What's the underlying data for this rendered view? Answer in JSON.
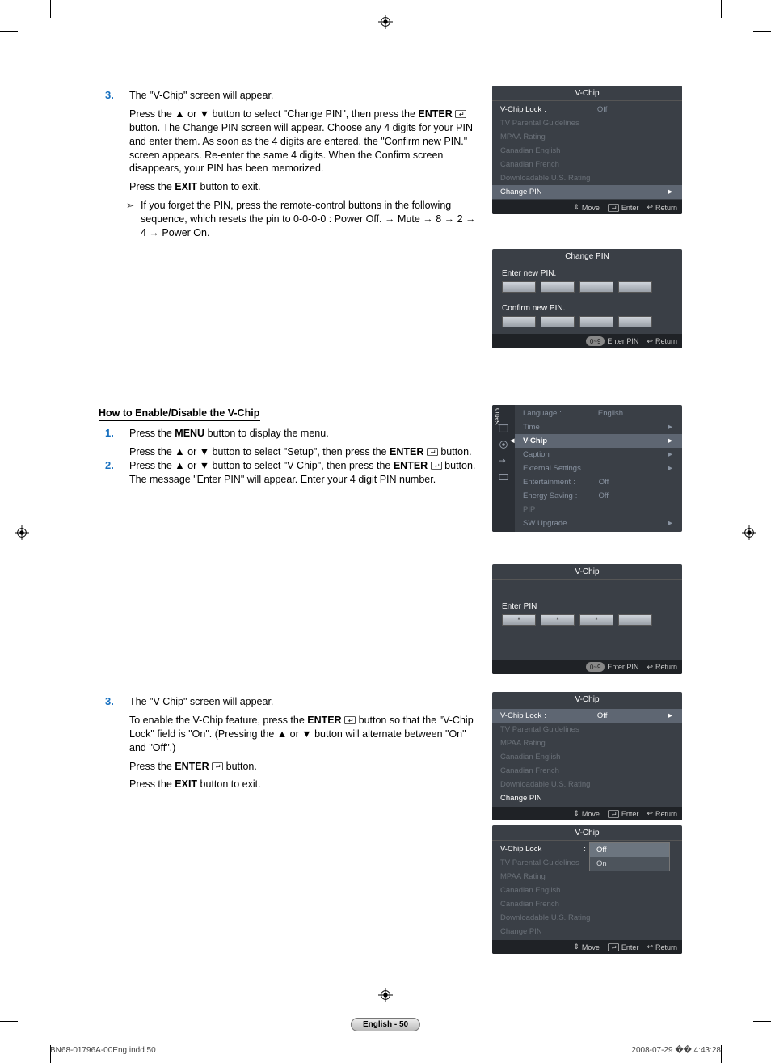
{
  "section1": {
    "step3_num": "3.",
    "step3a": "The \"V-Chip\" screen will appear.",
    "step3b_pre": "Press the ▲ or ▼ button to select \"Change PIN\", then press the ",
    "step3b_enter": "ENTER",
    "step3b_post": " button. The Change PIN screen will appear. Choose any 4 digits for your PIN and enter them. As soon as the 4 digits are entered, the \"Confirm new PIN.\" screen appears. Re-enter the same 4 digits. When the Confirm screen disappears, your PIN has been memorized.",
    "step3c_pre": "Press the ",
    "step3c_exit": "EXIT",
    "step3c_post": " button to exit.",
    "note": "If you forget the PIN, press the remote-control buttons in the following sequence, which resets the pin to 0-0-0-0 : Power Off. → Mute → 8 → 2 → 4 → Power On."
  },
  "section2": {
    "heading": "How to Enable/Disable the V-Chip",
    "step1_num": "1.",
    "step1a_pre": "Press the ",
    "step1a_menu": "MENU",
    "step1a_post": " button to display the menu.",
    "step1b_pre": "Press the ▲ or ▼ button to select \"Setup\", then press the ",
    "step1b_enter": "ENTER",
    "step1b_post": " button.",
    "step2_num": "2.",
    "step2a_pre": "Press the ▲ or ▼ button to select \"V-Chip\", then press the ",
    "step2a_enter": "ENTER",
    "step2a_post": " button. The message \"Enter PIN\" will appear. Enter your 4 digit PIN number."
  },
  "section3": {
    "step3_num": "3.",
    "step3a": "The \"V-Chip\" screen will appear.",
    "step3b_pre": "To enable the V-Chip feature, press the ",
    "step3b_enter": "ENTER",
    "step3b_post": " button so that the \"V-Chip Lock\" field is \"On\". (Pressing the ▲ or ▼ button will alternate between \"On\" and \"Off\".)",
    "step3c_pre": "Press the ",
    "step3c_enter": "ENTER",
    "step3c_post": " button.",
    "step3d_pre": "Press the ",
    "step3d_exit": "EXIT",
    "step3d_post": " button to exit."
  },
  "panel_vchip_top": {
    "title": "V-Chip",
    "rows": [
      {
        "label": "V-Chip Lock",
        "value": "Off",
        "style": "highlight"
      },
      {
        "label": "TV Parental Guidelines",
        "style": "disabled"
      },
      {
        "label": "MPAA Rating",
        "style": "disabled"
      },
      {
        "label": "Canadian English",
        "style": "disabled"
      },
      {
        "label": "Canadian French",
        "style": "disabled"
      },
      {
        "label": "Downloadable U.S. Rating",
        "style": "disabled"
      },
      {
        "label": "Change PIN",
        "style": "sel",
        "chev": "►"
      }
    ],
    "footer": {
      "move": "Move",
      "enter": "Enter",
      "return": "Return"
    }
  },
  "panel_change_pin": {
    "title": "Change PIN",
    "enter_label": "Enter new PIN.",
    "confirm_label": "Confirm new PIN.",
    "footer": {
      "badge": "0~9",
      "enter_pin": "Enter PIN",
      "return": "Return"
    }
  },
  "panel_setup": {
    "side_label": "Setup",
    "rows": [
      {
        "label": "Language",
        "value": "English"
      },
      {
        "label": "Time",
        "chev": "►"
      },
      {
        "label": "V-Chip",
        "style": "sel",
        "chev": "►"
      },
      {
        "label": "Caption",
        "chev": "►"
      },
      {
        "label": "External Settings",
        "chev": "►"
      },
      {
        "label": "Entertainment",
        "value": "Off"
      },
      {
        "label": "Energy Saving",
        "value": "Off"
      },
      {
        "label": "PIP",
        "style": "disabled"
      },
      {
        "label": "SW Upgrade",
        "chev": "►"
      }
    ]
  },
  "panel_enter_pin": {
    "title": "V-Chip",
    "label": "Enter PIN",
    "dots": [
      "*",
      "*",
      "*",
      ""
    ],
    "footer": {
      "badge": "0~9",
      "enter_pin": "Enter PIN",
      "return": "Return"
    }
  },
  "panel_vchip_lock": {
    "title": "V-Chip",
    "rows": [
      {
        "label": "V-Chip Lock",
        "value": "Off",
        "style": "sel",
        "chev": "►"
      },
      {
        "label": "TV Parental Guidelines",
        "style": "disabled"
      },
      {
        "label": "MPAA Rating",
        "style": "disabled"
      },
      {
        "label": "Canadian English",
        "style": "disabled"
      },
      {
        "label": "Canadian French",
        "style": "disabled"
      },
      {
        "label": "Downloadable U.S. Rating",
        "style": "disabled"
      },
      {
        "label": "Change PIN",
        "style": "highlight"
      }
    ],
    "footer": {
      "move": "Move",
      "enter": "Enter",
      "return": "Return"
    }
  },
  "panel_vchip_dropdown": {
    "title": "V-Chip",
    "rows": [
      {
        "label": "V-Chip Lock",
        "style": "highlight"
      },
      {
        "label": "TV Parental Guidelines",
        "style": "disabled"
      },
      {
        "label": "MPAA Rating",
        "style": "disabled"
      },
      {
        "label": "Canadian English",
        "style": "disabled"
      },
      {
        "label": "Canadian French",
        "style": "disabled"
      },
      {
        "label": "Downloadable U.S. Rating",
        "style": "disabled"
      },
      {
        "label": "Change PIN",
        "style": "disabled"
      }
    ],
    "dropdown_colon": ":",
    "dropdown": [
      "Off",
      "On"
    ],
    "footer": {
      "move": "Move",
      "enter": "Enter",
      "return": "Return"
    }
  },
  "page_footer": {
    "pill": "English - 50",
    "left": "BN68-01796A-00Eng.indd   50",
    "right": "2008-07-29   �� 4:43:28"
  },
  "symbols": {
    "updown": "⇕",
    "enter": "↵",
    "return": "↩"
  }
}
